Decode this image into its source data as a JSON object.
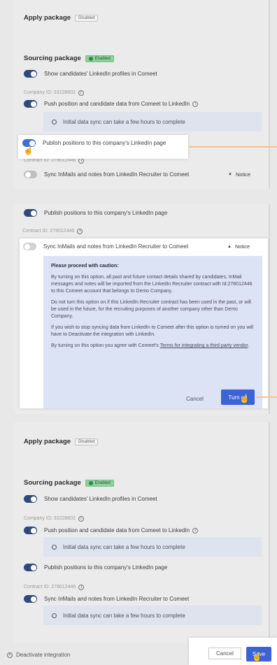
{
  "panel1": {
    "apply_package": "Apply package",
    "apply_badge": "Disabled",
    "sourcing_package": "Sourcing package",
    "sourcing_badge": "Enabled",
    "show_profiles": "Show candidates' LinkedIn profiles in Comeet",
    "company_id": "Company ID: 33228602",
    "push_data": "Push position and candidate data from Comeet to LinkedIn",
    "sync_note": "Initial data sync can take a few hours to complete",
    "publish_positions": "Publish positions to this company's LinkedIn page",
    "contract_id": "Contract ID: 278012446",
    "sync_inmails": "Sync InMails and notes from LinkedIn Recruiter to Comeet",
    "notice": "Notice"
  },
  "panel2": {
    "publish_positions": "Publish positions to this company's LinkedIn page",
    "contract_id": "Contract ID: 278012446",
    "sync_inmails": "Sync InMails and notes from LinkedIn Recruiter to Comeet",
    "notice": "Notice",
    "caution_title": "Please proceed with caution:",
    "para1": "By turning on this option, all past and future contact details shared by candidates, InMail messages and notes will be imported from the LinkedIn Recruiter contract with Id:278012446 to this Comeet account that belongs to Demo Company.",
    "para2": "Do not turn this option on if this LinkedIn Recruiter contract has been used in the past, or will be used in the future, for the recruiting purposes of another company other than Demo Company.",
    "para3": "If you wish to stop syncing data from LinkedIn to Comeet after this option is turned on you will have to Deactivate the integration with LinkedIn.",
    "para4_prefix": "By turning on this option you agree with Comeet's ",
    "para4_link": "Terms for integrating a third party vendor",
    "para4_suffix": ".",
    "cancel": "Cancel",
    "turn_on": "Turn on"
  },
  "panel3": {
    "apply_package": "Apply package",
    "apply_badge": "Disabled",
    "sourcing_package": "Sourcing package",
    "sourcing_badge": "Enabled",
    "show_profiles": "Show candidates' LinkedIn profiles in Comeet",
    "company_id": "Company ID: 33228602",
    "push_data": "Push position and candidate data from Comeet to LinkedIn",
    "sync_note": "Initial data sync can take a few hours to complete",
    "publish_positions": "Publish positions to this company's LinkedIn page",
    "contract_id": "Contract ID: 278012446",
    "sync_inmails": "Sync InMails and notes from LinkedIn Recruiter to Comeet",
    "sync_note2": "Initial data sync can take a few hours to complete"
  },
  "footer": {
    "deactivate": "Deactivate integration",
    "cancel": "Cancel",
    "save": "Save"
  },
  "colors": {
    "accent": "#3b63d6",
    "toggle_on": "#2f4a7a",
    "enabled_green": "#8fcf9d",
    "caution_bg": "#dbe3f5",
    "connector": "#f4c48b"
  }
}
